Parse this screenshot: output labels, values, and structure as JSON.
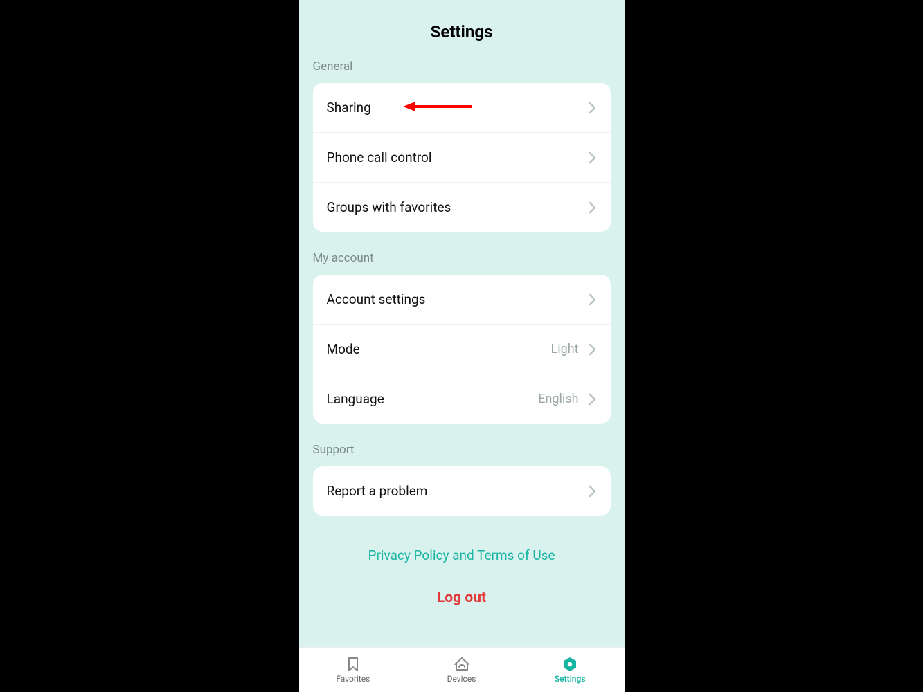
{
  "page_title": "Settings",
  "sections": {
    "general": {
      "header": "General",
      "items": {
        "sharing": "Sharing",
        "phone_call_control": "Phone call control",
        "groups_with_favorites": "Groups with favorites"
      }
    },
    "my_account": {
      "header": "My account",
      "items": {
        "account_settings": "Account settings",
        "mode": {
          "label": "Mode",
          "value": "Light"
        },
        "language": {
          "label": "Language",
          "value": "English"
        }
      }
    },
    "support": {
      "header": "Support",
      "items": {
        "report_problem": "Report a problem"
      }
    }
  },
  "footer": {
    "privacy_policy": "Privacy Policy",
    "and": " and ",
    "terms_of_use": "Terms of Use"
  },
  "logout": "Log out",
  "tabs": {
    "favorites": "Favorites",
    "devices": "Devices",
    "settings": "Settings"
  },
  "annotation": {
    "arrow_points_to": "sharing"
  },
  "colors": {
    "accent": "#19b5a3",
    "danger": "#e23b3b",
    "bg": "#d9f2ed",
    "muted": "#9aa5a5"
  }
}
